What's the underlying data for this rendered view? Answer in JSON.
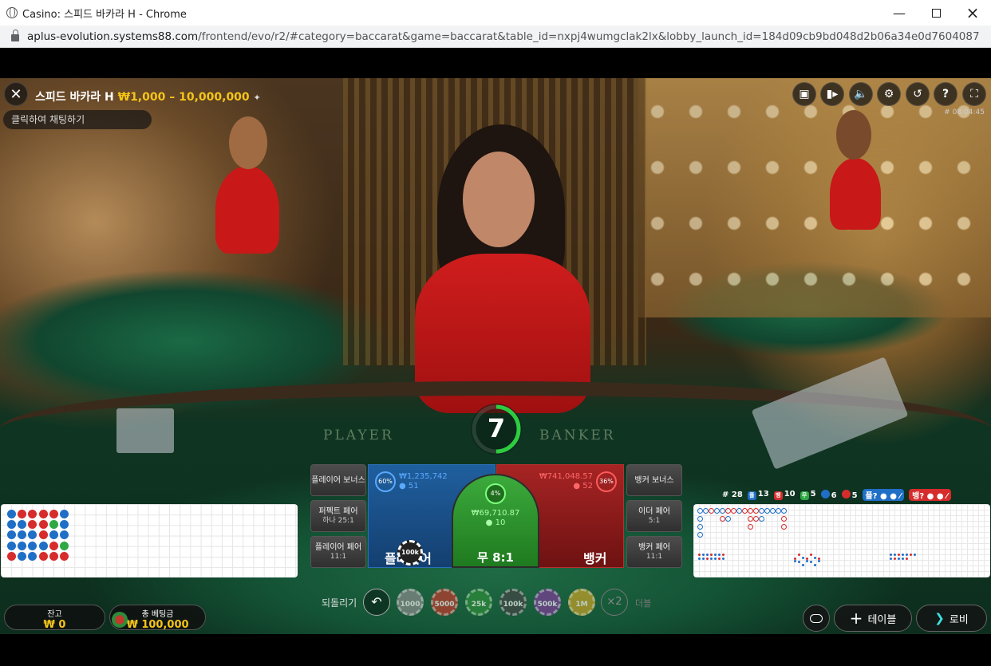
{
  "window": {
    "title": "Casino: 스피드 바카라 H - Chrome",
    "url_host": "aplus-evolution.systems88.com",
    "url_path": "/frontend/evo/r2/#category=baccarat&game=baccarat&table_id=nxpj4wumgclak2lx&lobby_launch_id=184d09cb9bd048d2b06a34e0d7604087"
  },
  "header": {
    "table_name": "스피드 바카라 H",
    "limits": "₩1,000 – 10,000,000",
    "chat_placeholder": "클릭하여 채팅하기",
    "round_time": "# 08:04:45"
  },
  "table_felt": {
    "player": "PLAYER",
    "banker": "BANKER"
  },
  "timer": {
    "seconds": "7",
    "remaining_fraction": 0.5
  },
  "bets": {
    "player_bonus": "플레이어 보너스",
    "perfect_pair": "퍼펙트 페어",
    "perfect_pair_odds": "하나 25:1",
    "player_pair": "플레이어 페어",
    "player_pair_odds": "11:1",
    "banker_bonus": "뱅커 보너스",
    "either_pair": "이더 페어",
    "either_pair_odds": "5:1",
    "banker_pair": "뱅커 페어",
    "banker_pair_odds": "11:1",
    "player": {
      "label": "플레이어",
      "pct": "60%",
      "amount": "₩1,235,742",
      "players": "51"
    },
    "tie": {
      "label": "무 8:1",
      "pct": "4%",
      "amount": "₩69,710.87",
      "players": "10"
    },
    "banker": {
      "label": "뱅커",
      "pct": "36%",
      "amount": "₩741,048.57",
      "players": "52"
    },
    "placed_chip": "100k"
  },
  "summary": {
    "rounds": "# 28",
    "player": "13",
    "banker": "10",
    "tie": "5",
    "player_pair": "6",
    "banker_pair": "5",
    "player_ask": "플?",
    "banker_ask": "뱅?",
    "player_sym": "플",
    "banker_sym": "뱅",
    "tie_sym": "무"
  },
  "wallet": {
    "balance_label": "잔고",
    "balance": "₩ 0",
    "total_bet_label": "총 베팅금",
    "total_bet": "₩ 100,000"
  },
  "controls": {
    "undo_label": "되돌리기",
    "double_label": "더블",
    "double_symbol": "×2",
    "table_button": "테이블",
    "lobby_button": "로비"
  },
  "chips": [
    {
      "label": "1000",
      "color": "#8a8a8a"
    },
    {
      "label": "5000",
      "color": "#c0392b"
    },
    {
      "label": "25k",
      "color": "#2e8b3a"
    },
    {
      "label": "100k",
      "color": "#444444"
    },
    {
      "label": "500k",
      "color": "#7d3c98"
    },
    {
      "label": "1M",
      "color": "#c9a227"
    }
  ],
  "colors": {
    "player": "#1f6fc7",
    "banker": "#d62c2c",
    "tie": "#2ea843",
    "gold": "#f5c518"
  }
}
